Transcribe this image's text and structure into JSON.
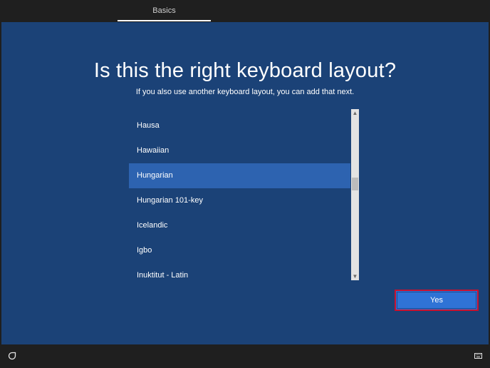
{
  "header": {
    "tab_label": "Basics"
  },
  "main": {
    "title": "Is this the right keyboard layout?",
    "subtitle": "If you also use another keyboard layout, you can add that next."
  },
  "layout_list": {
    "items": [
      {
        "label": "Hausa",
        "selected": false
      },
      {
        "label": "Hawaiian",
        "selected": false
      },
      {
        "label": "Hungarian",
        "selected": true
      },
      {
        "label": "Hungarian 101-key",
        "selected": false
      },
      {
        "label": "Icelandic",
        "selected": false
      },
      {
        "label": "Igbo",
        "selected": false
      },
      {
        "label": "Inuktitut - Latin",
        "selected": false
      }
    ],
    "scroll_up_icon": "chevron-up-icon",
    "scroll_down_icon": "chevron-down-icon"
  },
  "actions": {
    "yes_label": "Yes"
  },
  "footer": {
    "left_icon": "accessibility-icon",
    "right_icon": "keyboard-icon"
  },
  "colors": {
    "background_blue": "#1b4277",
    "selected_item": "#2d63b0",
    "button_blue": "#2f73d6",
    "focus_border": "#c8102e"
  }
}
